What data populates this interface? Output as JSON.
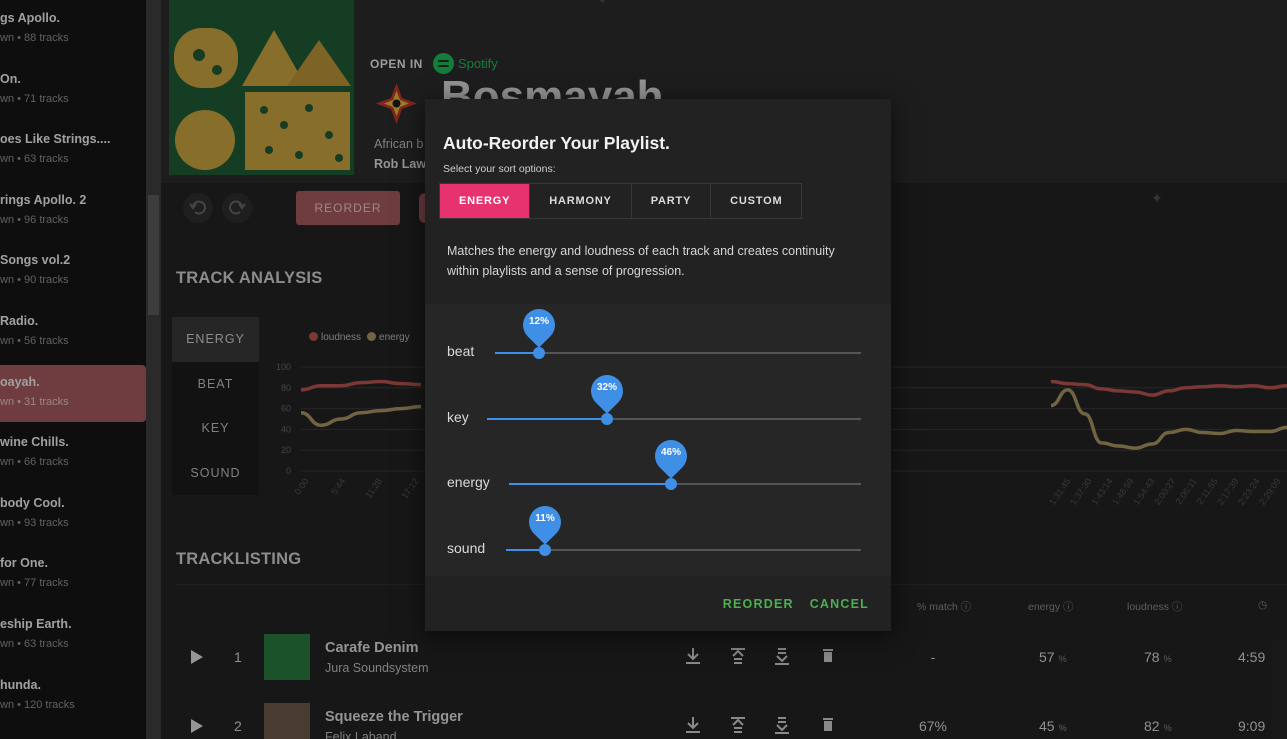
{
  "sidebar": {
    "playlists": [
      {
        "title": "gs Apollo.",
        "subtitle": "wn • 88 tracks"
      },
      {
        "title": "On.",
        "subtitle": "wn • 71 tracks"
      },
      {
        "title": "oes Like Strings....",
        "subtitle": "wn • 63 tracks"
      },
      {
        "title": "rings Apollo. 2",
        "subtitle": "wn • 96 tracks"
      },
      {
        "title": "Songs vol.2",
        "subtitle": "wn • 90 tracks"
      },
      {
        "title": "Radio.",
        "subtitle": "wn • 56 tracks"
      },
      {
        "title": "oayah.",
        "subtitle": "wn • 31 tracks",
        "active": true
      },
      {
        "title": "wine Chills.",
        "subtitle": "wn • 66 tracks"
      },
      {
        "title": "body Cool.",
        "subtitle": "wn • 93 tracks"
      },
      {
        "title": "for One.",
        "subtitle": "wn • 77 tracks"
      },
      {
        "title": "eship Earth.",
        "subtitle": "wn • 63 tracks"
      },
      {
        "title": "hunda.",
        "subtitle": "wn • 120 tracks"
      }
    ]
  },
  "header": {
    "open_in": "OPEN IN",
    "spotify": "Spotify",
    "playlist_name": "Bosmayah",
    "genre": "African b",
    "curator": "Rob Law"
  },
  "toolbar": {
    "reorder_label": "REORDER"
  },
  "analysis": {
    "section_title": "TRACK ANALYSIS",
    "tabs": [
      "ENERGY",
      "BEAT",
      "KEY",
      "SOUND"
    ],
    "active_tab": "ENERGY",
    "legend": [
      "loudness",
      "energy"
    ],
    "colors": {
      "loudness": "#b5534f",
      "energy": "#a99463"
    }
  },
  "chart_data": {
    "type": "line",
    "ylim": [
      0,
      100
    ],
    "yticks": [
      0,
      20,
      40,
      60,
      80,
      100
    ],
    "x_visible_left": [
      "0:00",
      "5:44",
      "11:28",
      "17:12"
    ],
    "x_visible_right": [
      "1:31:45",
      "1:37:30",
      "1:43:14",
      "1:48:59",
      "1:54:43",
      "2:00:27",
      "2:06:11",
      "2:11:55",
      "2:17:39",
      "2:23:24",
      "2:29:09"
    ],
    "series": [
      {
        "name": "loudness",
        "values_left": [
          78,
          82,
          82,
          85,
          86,
          84,
          83
        ],
        "values_right": [
          86,
          84,
          83,
          79,
          77,
          76,
          73,
          77,
          80,
          81,
          82,
          81,
          82,
          80,
          82
        ]
      },
      {
        "name": "energy",
        "values_left": [
          56,
          44,
          50,
          56,
          58,
          60,
          62
        ],
        "values_right": [
          63,
          78,
          55,
          27,
          24,
          22,
          26,
          37,
          40,
          37,
          36,
          39,
          38,
          38,
          42
        ]
      }
    ]
  },
  "tracklist": {
    "section_title": "TRACKLISTING",
    "columns": [
      "% match",
      "energy",
      "loudness"
    ],
    "rows": [
      {
        "num": "1",
        "name": "Carafe Denim",
        "artist": "Jura Soundsystem",
        "match": "-",
        "energy": "57",
        "loudness": "78",
        "duration": "4:59"
      },
      {
        "num": "2",
        "name": "Squeeze the Trigger",
        "artist": "Felix Laband",
        "match": "67%",
        "energy": "45",
        "loudness": "82",
        "duration": "9:09"
      }
    ],
    "pct_unit": "%"
  },
  "dialog": {
    "title": "Auto-Reorder Your Playlist.",
    "subtitle": "Select your sort options:",
    "tabs": [
      "ENERGY",
      "HARMONY",
      "PARTY",
      "CUSTOM"
    ],
    "active_tab": "ENERGY",
    "description": "Matches the energy and loudness of each track and creates continuity within playlists and a sense of progression.",
    "sliders": [
      {
        "label": "beat",
        "value": 0.12,
        "display": "12%"
      },
      {
        "label": "key",
        "value": 0.32,
        "display": "32%"
      },
      {
        "label": "energy",
        "value": 0.46,
        "display": "46%"
      },
      {
        "label": "sound",
        "value": 0.11,
        "display": "11%"
      }
    ],
    "reorder_label": "REORDER",
    "cancel_label": "CANCEL",
    "accent": "#e6336f",
    "slider_color": "#3f8fe6",
    "action_color": "#4caf50"
  }
}
